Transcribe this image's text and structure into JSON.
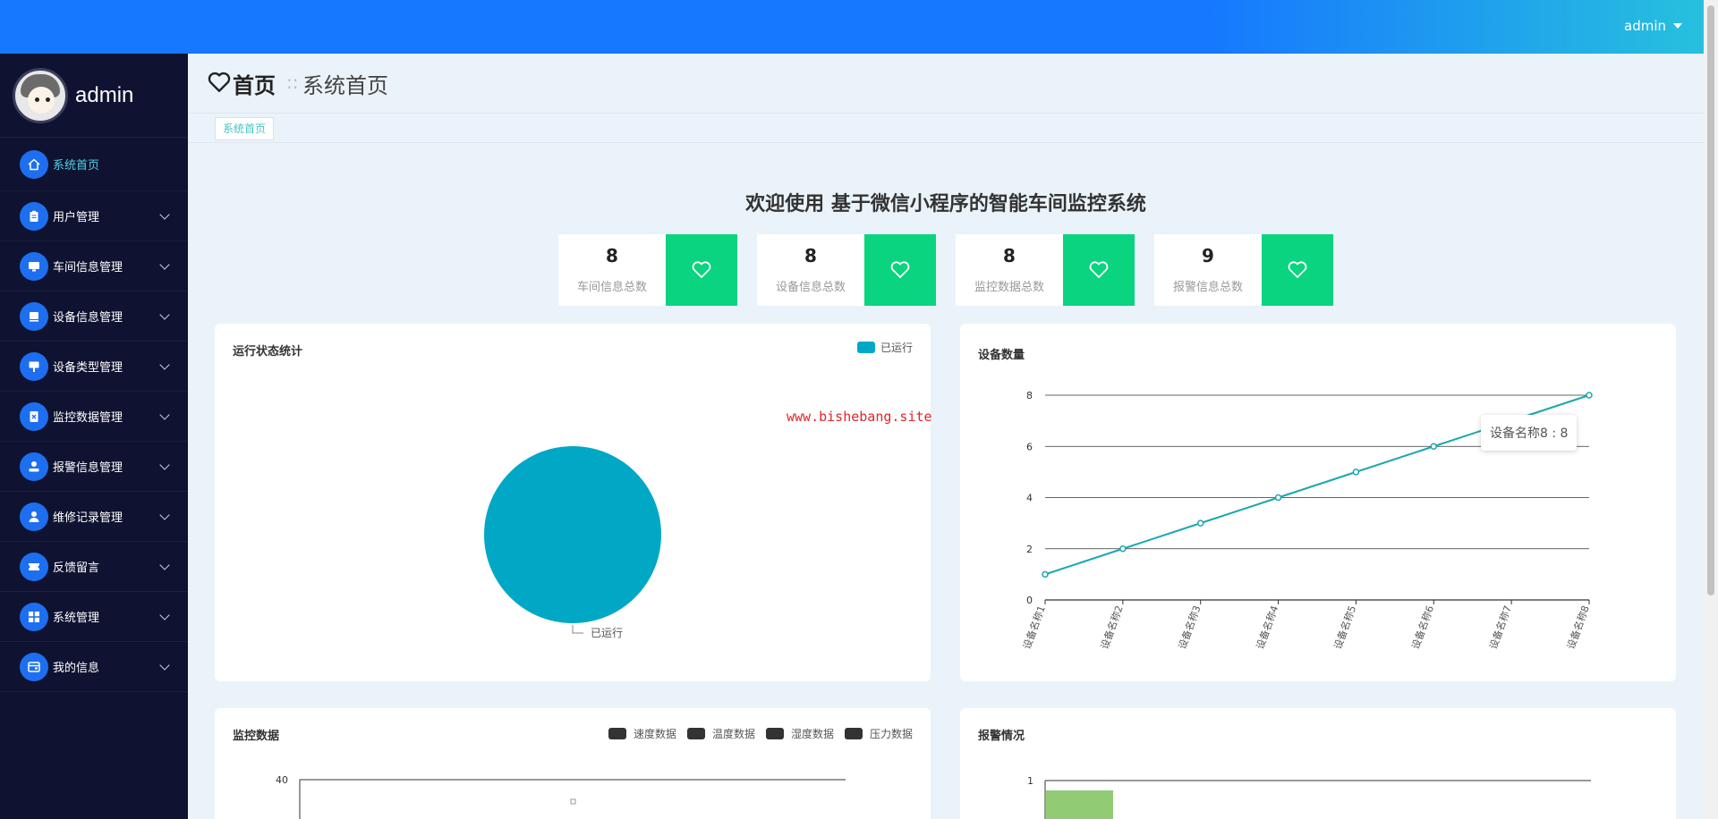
{
  "topbar": {
    "user_label": "admin"
  },
  "sidebar": {
    "username": "admin",
    "items": [
      {
        "label": "系统首页",
        "icon": "home-icon",
        "active": true,
        "expandable": false
      },
      {
        "label": "用户管理",
        "icon": "clipboard-icon",
        "active": false,
        "expandable": true
      },
      {
        "label": "车间信息管理",
        "icon": "monitor-icon",
        "active": false,
        "expandable": true
      },
      {
        "label": "设备信息管理",
        "icon": "device-icon",
        "active": false,
        "expandable": true
      },
      {
        "label": "设备类型管理",
        "icon": "easel-icon",
        "active": false,
        "expandable": true
      },
      {
        "label": "监控数据管理",
        "icon": "document-icon",
        "active": false,
        "expandable": true
      },
      {
        "label": "报警信息管理",
        "icon": "user-desk-icon",
        "active": false,
        "expandable": true
      },
      {
        "label": "维修记录管理",
        "icon": "person-icon",
        "active": false,
        "expandable": true
      },
      {
        "label": "反馈留言",
        "icon": "ticket-icon",
        "active": false,
        "expandable": true
      },
      {
        "label": "系统管理",
        "icon": "grid-icon",
        "active": false,
        "expandable": true
      },
      {
        "label": "我的信息",
        "icon": "card-icon",
        "active": false,
        "expandable": true
      }
    ]
  },
  "breadcrumb": {
    "home": "首页",
    "separator": "::",
    "current": "系统首页"
  },
  "tabs": [
    {
      "label": "系统首页"
    }
  ],
  "welcome": "欢迎使用 基于微信小程序的智能车间监控系统",
  "stats": [
    {
      "value": "8",
      "caption": "车间信息总数"
    },
    {
      "value": "8",
      "caption": "设备信息总数"
    },
    {
      "value": "8",
      "caption": "监控数据总数"
    },
    {
      "value": "9",
      "caption": "报警信息总数"
    }
  ],
  "watermark": "www.bishebang.site",
  "colors": {
    "accent": "#1677ff",
    "stat_green": "#0ad480",
    "pie": "#00a8c6",
    "line": "#1aa7b0",
    "bar": "#91cc75",
    "sidebar_bg": "#0f1331"
  },
  "chart_data": [
    {
      "type": "pie",
      "title": "运行状态统计",
      "legend": [
        "已运行"
      ],
      "legend_position": "top-right",
      "slices": [
        {
          "name": "已运行",
          "value": 1
        }
      ]
    },
    {
      "type": "line",
      "title": "设备数量",
      "categories": [
        "设备名称1",
        "设备名称2",
        "设备名称3",
        "设备名称4",
        "设备名称5",
        "设备名称6",
        "设备名称7",
        "设备名称8"
      ],
      "values": [
        1,
        2,
        3,
        4,
        5,
        6,
        7,
        8
      ],
      "ylim": [
        0,
        8
      ],
      "yticks": [
        0,
        2,
        4,
        6,
        8
      ],
      "grid": true,
      "tooltip": "设备名称8 : 8"
    },
    {
      "type": "bar",
      "title": "监控数据",
      "legend": [
        "速度数据",
        "温度数据",
        "湿度数据",
        "压力数据"
      ],
      "legend_position": "top-right",
      "yticks": [
        40
      ]
    },
    {
      "type": "bar",
      "title": "报警情况",
      "yticks": [
        1
      ]
    }
  ]
}
